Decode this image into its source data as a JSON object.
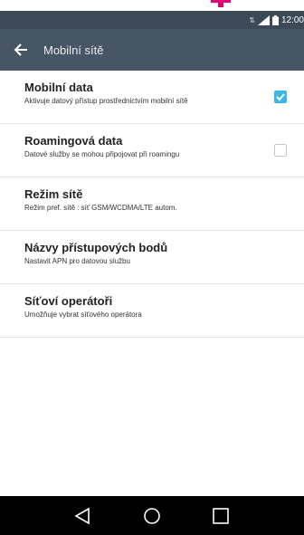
{
  "status_bar": {
    "time": "12:00",
    "icons": [
      "network-icon",
      "signal-icon",
      "battery-icon"
    ]
  },
  "colors": {
    "status_bar_bg": "#3c4956",
    "app_bar_bg": "#475665",
    "accent": "#3ab7e6",
    "brand_mark": "#e20074"
  },
  "app_bar": {
    "title": "Mobilní sítě",
    "back_icon": "back-arrow-icon"
  },
  "settings": [
    {
      "title": "Mobilní data",
      "subtitle": "Aktivuje datový přístup prostřednictvím mobilní sítě",
      "checkbox": true,
      "checked": true
    },
    {
      "title": "Roamingová data",
      "subtitle": "Datové služby se mohou připojovat při roamingu",
      "checkbox": true,
      "checked": false
    },
    {
      "title": "Režim sítě",
      "subtitle": "Režim pref. sítě : síť GSM/WCDMA/LTE autom."
    },
    {
      "title": "Názvy přístupových bodů",
      "subtitle": "Nastavit APN pro datovou službu"
    },
    {
      "title": "Síťoví operátoři",
      "subtitle": "Umožňuje vybrat síťového operátora"
    }
  ],
  "nav_bar": {
    "buttons": [
      "back-triangle-icon",
      "home-circle-icon",
      "recents-square-icon"
    ]
  }
}
